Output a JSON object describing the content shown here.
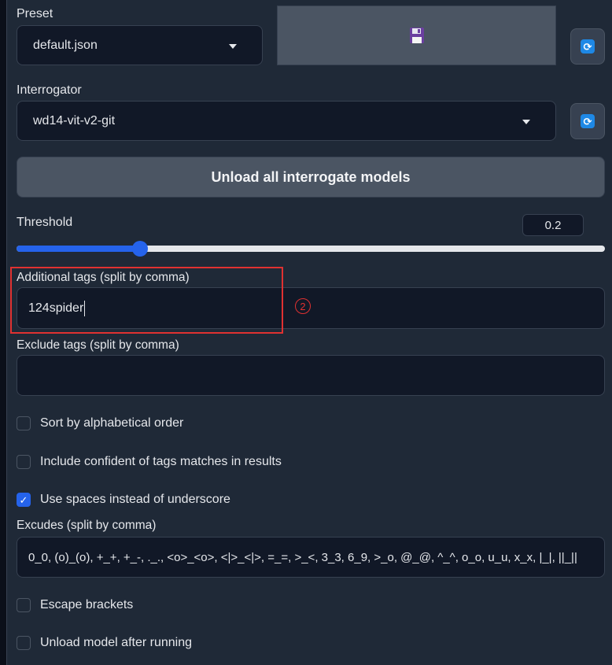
{
  "preset": {
    "label": "Preset",
    "value": "default.json"
  },
  "interrogator": {
    "label": "Interrogator",
    "value": "wd14-vit-v2-git"
  },
  "unload_button": "Unload all interrogate models",
  "threshold": {
    "label": "Threshold",
    "value": "0.2",
    "fraction": 0.2
  },
  "additional_tags": {
    "label": "Additional tags (split by comma)",
    "value": "124spider",
    "annotation": "2"
  },
  "exclude_tags": {
    "label": "Exclude tags (split by comma)",
    "value": ""
  },
  "checkboxes": [
    {
      "label": "Sort by alphabetical order",
      "checked": false
    },
    {
      "label": "Include confident of tags matches in results",
      "checked": false
    },
    {
      "label": "Use spaces instead of underscore",
      "checked": true
    }
  ],
  "excludes": {
    "label": "Excudes (split by comma)",
    "value": "0_0, (o)_(o), +_+, +_-, ._., <o>_<o>, <|>_<|>, =_=, >_<, 3_3, 6_9, >_o, @_@, ^_^, o_o, u_u, x_x, |_|, ||_||"
  },
  "checkboxes2": [
    {
      "label": "Escape brackets",
      "checked": false
    },
    {
      "label": "Unload model after running",
      "checked": false
    }
  ],
  "colors": {
    "accent": "#2563eb",
    "annotation": "#e03131",
    "panel": "#1f2937"
  }
}
